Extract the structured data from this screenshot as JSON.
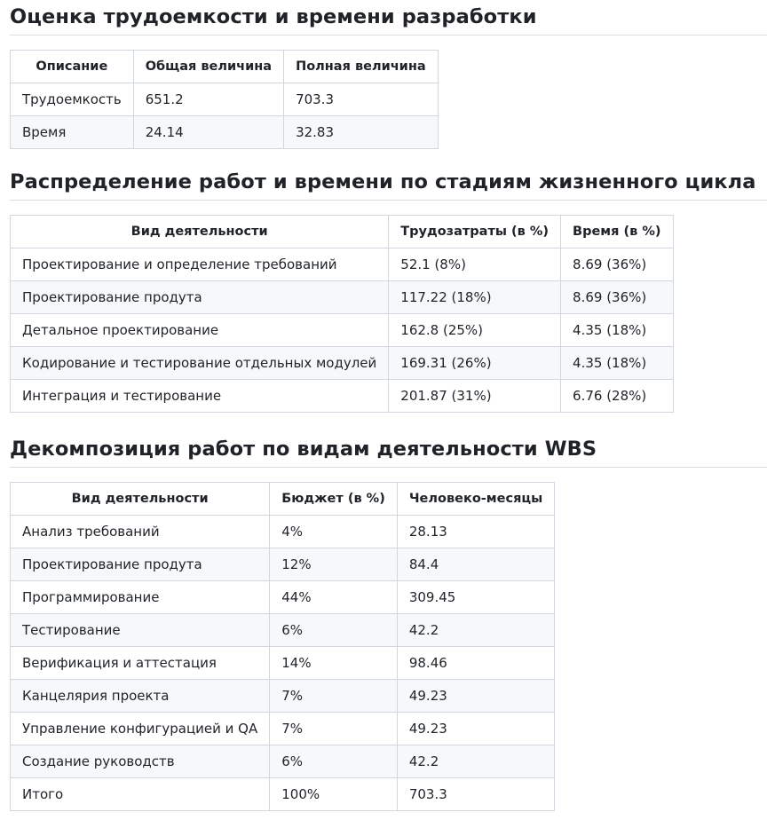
{
  "sections": [
    {
      "title": "Оценка трудоемкости и времени разработки",
      "headers": [
        "Описание",
        "Общая величина",
        "Полная величина"
      ],
      "rows": [
        [
          "Трудоемкость",
          "651.2",
          "703.3"
        ],
        [
          "Время",
          "24.14",
          "32.83"
        ]
      ]
    },
    {
      "title": "Распределение работ и времени по стадиям жизненного цикла",
      "headers": [
        "Вид деятельности",
        "Трудозатраты (в %)",
        "Время (в %)"
      ],
      "rows": [
        [
          "Проектирование и определение требований",
          "52.1 (8%)",
          "8.69 (36%)"
        ],
        [
          "Проектирование продута",
          "117.22 (18%)",
          "8.69 (36%)"
        ],
        [
          "Детальное проектирование",
          "162.8 (25%)",
          "4.35 (18%)"
        ],
        [
          "Кодирование и тестирование отдельных модулей",
          "169.31 (26%)",
          "4.35 (18%)"
        ],
        [
          "Интеграция и тестирование",
          "201.87 (31%)",
          "6.76 (28%)"
        ]
      ]
    },
    {
      "title": "Декомпозиция работ по видам деятельности WBS",
      "headers": [
        "Вид деятельности",
        "Бюджет (в %)",
        "Человеко-месяцы"
      ],
      "rows": [
        [
          "Анализ требований",
          "4%",
          "28.13"
        ],
        [
          "Проектирование продута",
          "12%",
          "84.4"
        ],
        [
          "Программирование",
          "44%",
          "309.45"
        ],
        [
          "Тестирование",
          "6%",
          "42.2"
        ],
        [
          "Верификация и аттестация",
          "14%",
          "98.46"
        ],
        [
          "Канцелярия проекта",
          "7%",
          "49.23"
        ],
        [
          "Управление конфигурацией и QA",
          "7%",
          "49.23"
        ],
        [
          "Создание руководств",
          "6%",
          "42.2"
        ],
        [
          "Итого",
          "100%",
          "703.3"
        ]
      ]
    }
  ]
}
